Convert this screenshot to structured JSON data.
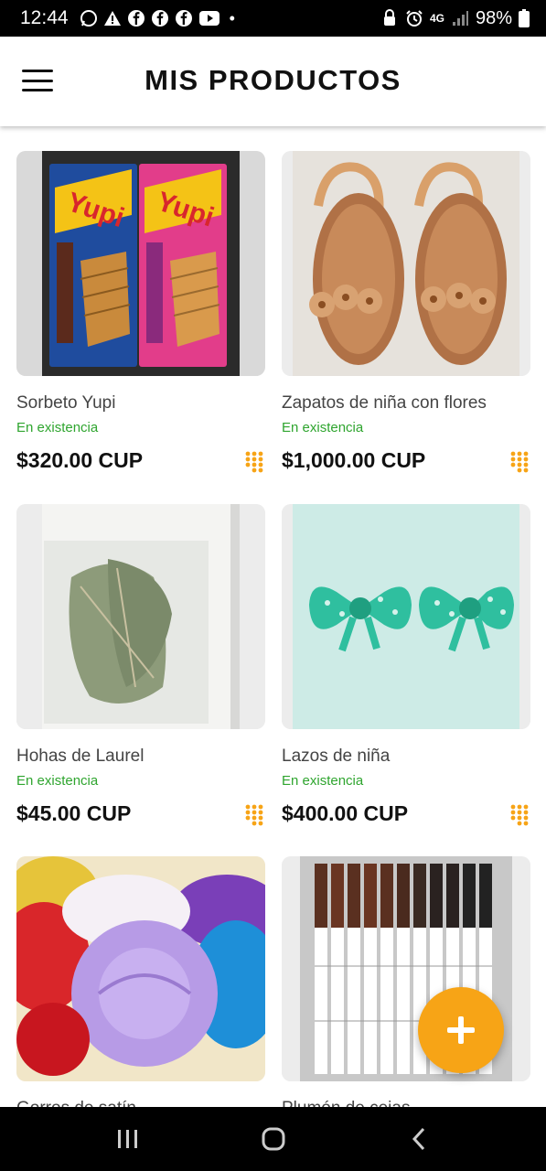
{
  "status_bar": {
    "time": "12:44",
    "network": "4G",
    "battery": "98%",
    "icons": [
      "whatsapp-icon",
      "alert-icon",
      "facebook-icon",
      "facebook-icon",
      "facebook-icon",
      "youtube-icon",
      "more-dot-icon",
      "lock-icon",
      "alarm-icon",
      "signal-icon",
      "battery-icon"
    ]
  },
  "header": {
    "title": "MIS PRODUCTOS",
    "menu_icon": "hamburger-menu-icon"
  },
  "products": [
    {
      "name": "Sorbeto Yupi",
      "stock": "En existencia",
      "price": "$320.00 CUP",
      "image": "wafer-packs"
    },
    {
      "name": "Zapatos de niña con flores",
      "stock": "En existencia",
      "price": "$1,000.00 CUP",
      "image": "sandals"
    },
    {
      "name": "Hohas de Laurel",
      "stock": "En existencia",
      "price": "$45.00 CUP",
      "image": "bay-leaves-bag"
    },
    {
      "name": "Lazos de niña",
      "stock": "En existencia",
      "price": "$400.00 CUP",
      "image": "teal-bows"
    },
    {
      "name": "Gorros de satín",
      "stock": "",
      "price": "",
      "image": "satin-bonnets"
    },
    {
      "name": "Plumón de cejas",
      "stock": "",
      "price": "",
      "image": "eyebrow-pens"
    }
  ],
  "fab": {
    "icon": "plus-icon"
  },
  "nav_bar": {
    "items": [
      "recent-apps-icon",
      "home-icon",
      "back-icon"
    ]
  },
  "colors": {
    "accent": "#f7a416",
    "in_stock": "#2fa52f",
    "title": "#111111"
  }
}
